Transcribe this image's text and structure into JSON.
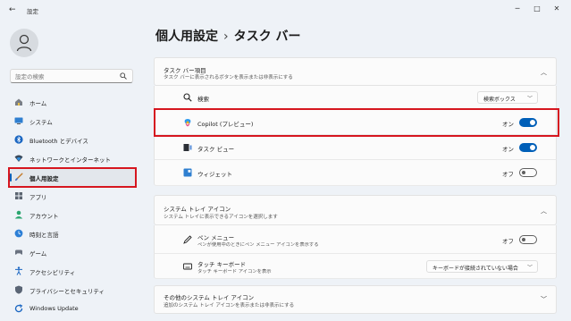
{
  "window": {
    "title": "設定",
    "back_icon": "←",
    "minimize_icon": "─",
    "maximize_icon": "□",
    "close_icon": "✕"
  },
  "sidebar": {
    "search_placeholder": "設定の検索",
    "items": [
      {
        "label": "ホーム",
        "icon": "home-icon"
      },
      {
        "label": "システム",
        "icon": "system-icon"
      },
      {
        "label": "Bluetooth とデバイス",
        "icon": "bluetooth-icon"
      },
      {
        "label": "ネットワークとインターネット",
        "icon": "network-icon"
      },
      {
        "label": "個人用設定",
        "icon": "brush-icon",
        "active": true
      },
      {
        "label": "アプリ",
        "icon": "apps-icon"
      },
      {
        "label": "アカウント",
        "icon": "account-icon"
      },
      {
        "label": "時刻と言語",
        "icon": "time-language-icon"
      },
      {
        "label": "ゲーム",
        "icon": "game-icon"
      },
      {
        "label": "アクセシビリティ",
        "icon": "accessibility-icon"
      },
      {
        "label": "プライバシーとセキュリティ",
        "icon": "privacy-icon"
      },
      {
        "label": "Windows Update",
        "icon": "update-icon"
      }
    ]
  },
  "header": {
    "breadcrumb_parent": "個人用設定",
    "breadcrumb_sep": "›",
    "breadcrumb_current": "タスク バー"
  },
  "taskbar_items": {
    "title": "タスク バー項目",
    "subtitle": "タスク バーに表示されるボタンを表示または非表示にする",
    "rows": [
      {
        "label": "検索",
        "control": "dropdown",
        "value": "検索ボックス"
      },
      {
        "label": "Copilot (プレビュー)",
        "control": "toggle",
        "state": "オン",
        "on": true
      },
      {
        "label": "タスク ビュー",
        "control": "toggle",
        "state": "オン",
        "on": true
      },
      {
        "label": "ウィジェット",
        "control": "toggle",
        "state": "オフ",
        "on": false
      }
    ]
  },
  "system_tray": {
    "title": "システム トレイ アイコン",
    "subtitle": "システム トレイに表示できるアイコンを選択します",
    "rows": [
      {
        "label": "ペン メニュー",
        "sub": "ペンが使用中のときにペン メニュー アイコンを表示する",
        "control": "toggle",
        "state": "オフ",
        "on": false
      },
      {
        "label": "タッチ キーボード",
        "sub": "タッチ キーボード アイコンを表示",
        "control": "dropdown",
        "value": "キーボードが接続されていない場合"
      }
    ]
  },
  "other_tray": {
    "title": "その他のシステム トレイ アイコン",
    "subtitle": "追加のシステム トレイ アイコンを表示または非表示にする"
  },
  "colors": {
    "accent": "#005fb8",
    "highlight": "#d6161f"
  }
}
